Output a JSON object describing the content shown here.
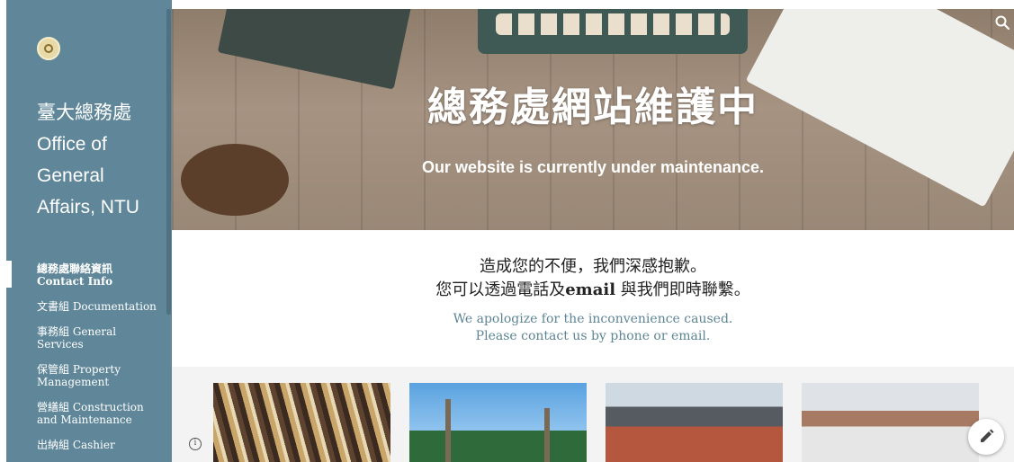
{
  "sidebar": {
    "logo_icon": "ntu-seal-icon",
    "title_lines": [
      "臺大總務處",
      "Office of",
      "General",
      "Affairs, NTU"
    ],
    "nav": [
      {
        "label": "總務處聯絡資訊 Contact Info",
        "active": true
      },
      {
        "label": "文書組 Documentation",
        "active": false
      },
      {
        "label": "事務組 General Services",
        "active": false
      },
      {
        "label": "保管組 Property Management",
        "active": false
      },
      {
        "label": "營繕組 Construction and Maintenance",
        "active": false
      },
      {
        "label": "出納組 Cashier",
        "active": false
      }
    ],
    "bg_color": "#5f8799"
  },
  "hero": {
    "title": "總務處網站維護中",
    "subtitle": "Our website is currently under maintenance.",
    "search_icon": "search-icon"
  },
  "message": {
    "cn_line1": "造成您的不便，我們深感抱歉。",
    "cn_line2_before": "您可以透過電話及",
    "cn_line2_email": "email",
    "cn_line2_after": " 與我們即時聯繫。",
    "en_line1": "We apologize for the inconvenience caused.",
    "en_line2": "Please contact us by phone or email.",
    "en_color": "#5d8594"
  },
  "footer": {
    "info_label": "i",
    "edit_icon": "pencil-icon"
  }
}
